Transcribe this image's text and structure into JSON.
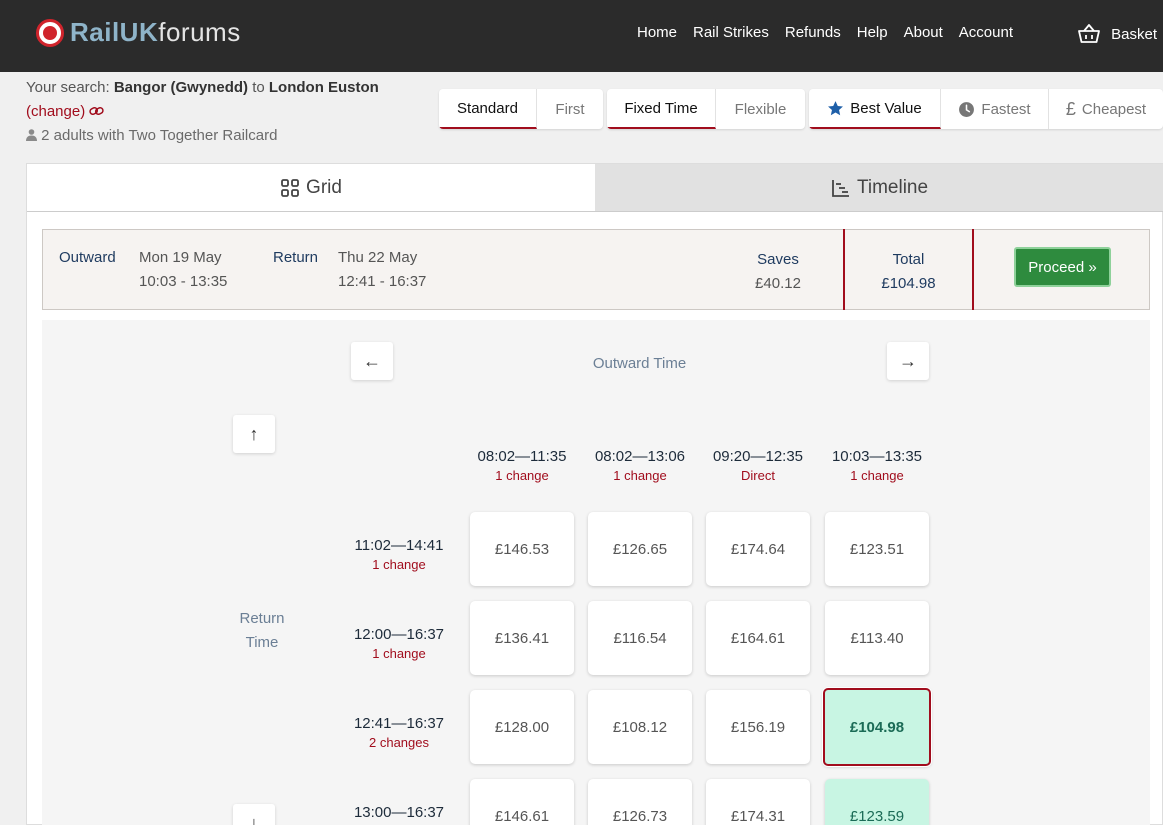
{
  "header": {
    "logo_part1": "RailUK",
    "logo_part2": "forums",
    "nav": [
      "Home",
      "Rail Strikes",
      "Refunds",
      "Help",
      "About",
      "Account"
    ],
    "basket_label": "Basket"
  },
  "search": {
    "prefix": "Your search:",
    "from": "Bangor (Gwynedd)",
    "to_word": "to",
    "to": "London Euston",
    "change_label": "(change)",
    "passengers": "2 adults with Two Together Railcard"
  },
  "toggles": {
    "class": [
      "Standard",
      "First"
    ],
    "ticket": [
      "Fixed Time",
      "Flexible"
    ],
    "sort": [
      "Best Value",
      "Fastest",
      "Cheapest"
    ]
  },
  "view_tabs": {
    "grid": "Grid",
    "timeline": "Timeline"
  },
  "summary": {
    "outward_label": "Outward",
    "outward_date": "Mon 19 May",
    "outward_time": "10:03 - 13:35",
    "return_label": "Return",
    "return_date": "Thu 22 May",
    "return_time": "12:41 - 16:37",
    "saves_label": "Saves",
    "saves_value": "£40.12",
    "total_label": "Total",
    "total_value": "£104.98",
    "proceed_label": "Proceed »"
  },
  "grid": {
    "prev_label": "←",
    "next_label": "→",
    "up_label": "↑",
    "down_label": "↓",
    "outward_axis": "Outward Time",
    "return_axis_1": "Return",
    "return_axis_2": "Time",
    "columns": [
      {
        "time": "08:02—11:35",
        "changes": "1 change"
      },
      {
        "time": "08:02—13:06",
        "changes": "1 change"
      },
      {
        "time": "09:20—12:35",
        "changes": "Direct"
      },
      {
        "time": "10:03—13:35",
        "changes": "1 change"
      }
    ],
    "rows": [
      {
        "time": "11:02—14:41",
        "changes": "1 change",
        "prices": [
          "£146.53",
          "£126.65",
          "£174.64",
          "£123.51"
        ]
      },
      {
        "time": "12:00—16:37",
        "changes": "1 change",
        "prices": [
          "£136.41",
          "£116.54",
          "£164.61",
          "£113.40"
        ]
      },
      {
        "time": "12:41—16:37",
        "changes": "2 changes",
        "prices": [
          "£128.00",
          "£108.12",
          "£156.19",
          "£104.98"
        ]
      },
      {
        "time": "13:00—16:37",
        "changes": "",
        "prices": [
          "£146.61",
          "£126.73",
          "£174.31",
          "£123.59"
        ]
      }
    ]
  }
}
